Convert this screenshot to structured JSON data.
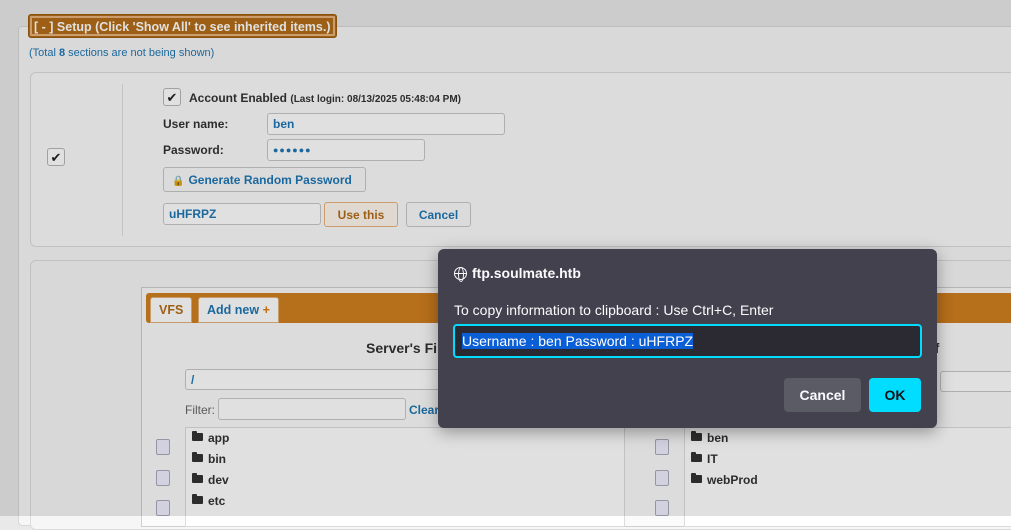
{
  "setup": {
    "header": "[ - ] Setup (Click 'Show All' to see inherited items.)",
    "total_prefix": "(Total ",
    "total_count": "8",
    "total_suffix": " sections are not being shown)"
  },
  "account": {
    "enabled_label": "Account Enabled",
    "last_login": "(Last login: 08/13/2025 05:48:04 PM)",
    "username_label": "User name:",
    "username_value": "ben",
    "password_label": "Password:",
    "password_masked": "●●●●●●",
    "generate_button": "Generate Random Password",
    "generated_value": "uHFRPZ",
    "use_this_button": "Use this",
    "cancel_button": "Cancel"
  },
  "vfs": {
    "tab_vfs": "VFS",
    "tab_add_new": "Add new",
    "add_icon": "+",
    "server_title": "Server's Fi",
    "right_title": "ff",
    "path_value": "/",
    "filter_label": "Filter:",
    "clear_link": "Clear",
    "server_items": [
      "app",
      "bin",
      "dev",
      "etc"
    ],
    "user_items": [
      "ben",
      "IT",
      "webProd"
    ]
  },
  "dialog": {
    "site": "ftp.soulmate.htb",
    "message": "To copy information to clipboard : Use Ctrl+C, Enter",
    "value": "Username : ben Password : uHFRPZ",
    "cancel_label": "Cancel",
    "ok_label": "OK",
    "colors": {
      "accent": "#00ddff",
      "background": "#42414d"
    }
  }
}
